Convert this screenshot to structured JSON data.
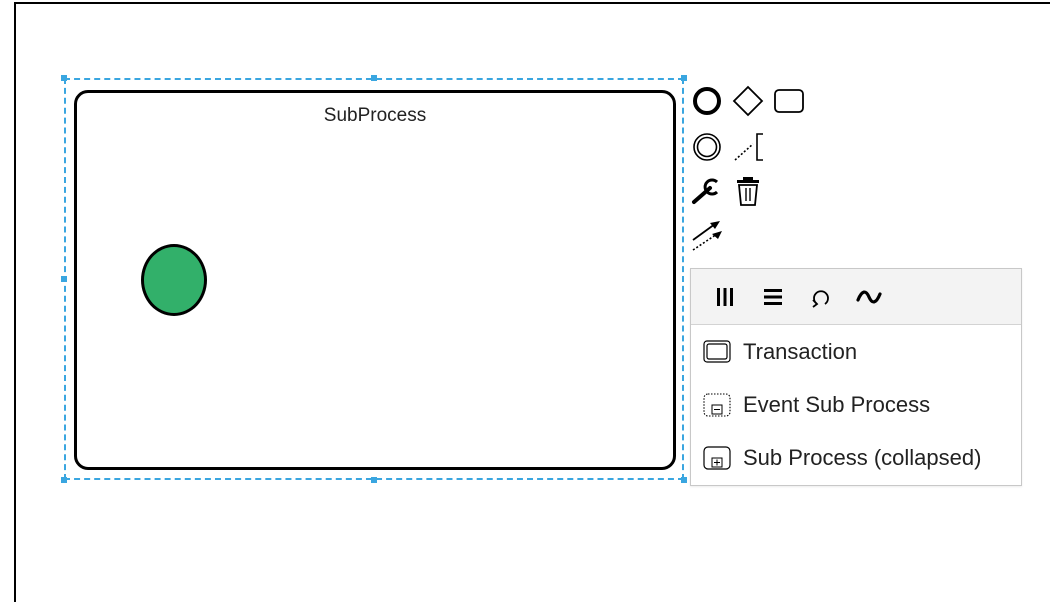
{
  "canvas": {
    "subprocess_label": "SubProcess",
    "start_event_color": "#32b06a",
    "selection_color": "#3aa6e0"
  },
  "context_pad": {
    "icons": [
      "end-event-icon",
      "gateway-icon",
      "task-icon",
      "intermediate-event-icon",
      "text-annotation-icon",
      "change-type-wrench-icon",
      "delete-trash-icon",
      "connect-arrow-icon"
    ]
  },
  "replace_menu": {
    "header_toggles": [
      "parallel-multi-instance-icon",
      "sequential-multi-instance-icon",
      "loop-icon",
      "ad-hoc-icon"
    ],
    "entries": [
      {
        "label": "Transaction",
        "icon": "transaction-icon"
      },
      {
        "label": "Event Sub Process",
        "icon": "event-subprocess-icon"
      },
      {
        "label": "Sub Process (collapsed)",
        "icon": "collapsed-subprocess-icon"
      }
    ]
  }
}
